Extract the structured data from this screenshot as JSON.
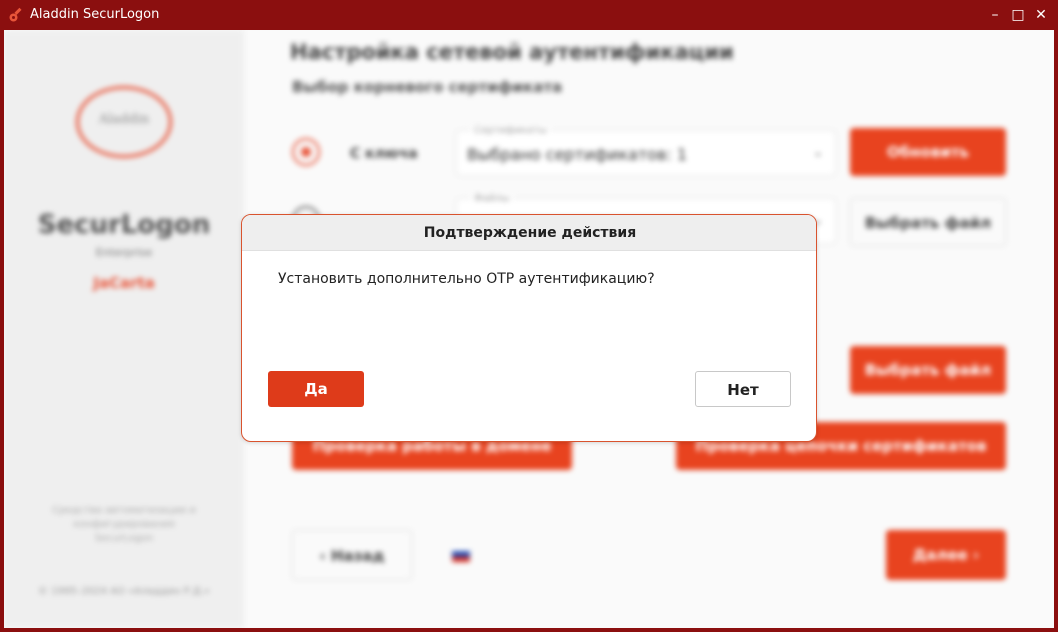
{
  "window": {
    "title": "Aladdin SecurLogon",
    "minimize_glyph": "–",
    "maximize_glyph": "□",
    "close_glyph": "✕",
    "accent_color": "#8b0f0f"
  },
  "sidebar": {
    "logo_text": "Aladdin",
    "product": "SecurLogon",
    "edition": "Enterprise",
    "variant": "JaCarta",
    "note": "Средства автоматизации и конфигурирования SecurLogon",
    "copyright": "© 1995–2024 АО «Аладдин Р.Д.»"
  },
  "main": {
    "title": "Настройка сетевой аутентификации",
    "subtitle": "Выбор корневого сертификата",
    "option_key_label": "С ключа",
    "cert_field": {
      "caption": "Сертификаты",
      "value": "Выбрано сертификатов: 1",
      "arrow": "⌄"
    },
    "file_field": {
      "caption": "Файлы",
      "value": "",
      "arrow": "⌄"
    },
    "refresh_button": "Обновить",
    "select_file_button": "Выбрать файл",
    "select_file_button_2": "Выбрать файл",
    "check_domain_button": "Проверка работы в домене",
    "check_chain_button": "Проверка цепочки сертификатов",
    "back_button": "‹  Назад",
    "next_button": "Далее  ›"
  },
  "dialog": {
    "title": "Подтверждение действия",
    "message": "Установить дополнительно OTP аутентификацию?",
    "yes_button": "Да",
    "no_button": "Нет",
    "accent_color": "#de3b1a"
  },
  "icons": {
    "app": "aladdin-key-icon",
    "language": "russian-flag-icon"
  }
}
